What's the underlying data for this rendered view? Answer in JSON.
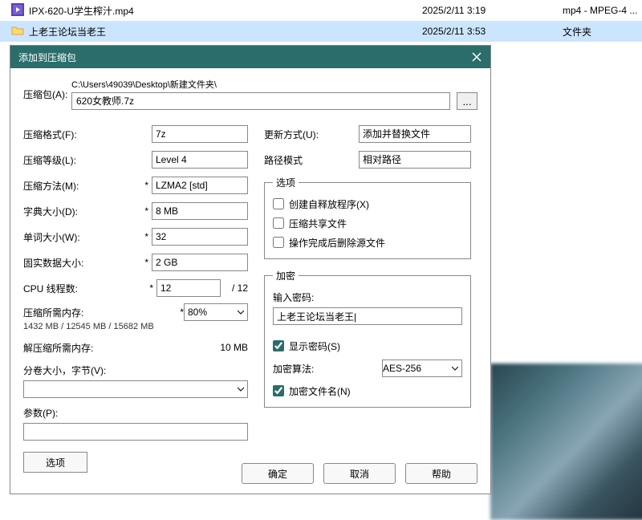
{
  "files": [
    {
      "name": "IPX-620-U学生榨汁.mp4",
      "date": "2025/2/11 3:19",
      "type": "mp4 - MPEG-4 ..."
    },
    {
      "name": "上老王论坛当老王",
      "date": "2025/2/11 3:53",
      "type": "文件夹"
    }
  ],
  "dialog": {
    "title": "添加到压缩包",
    "archive_label": "压缩包(A):",
    "archive_dir": "C:\\Users\\49039\\Desktop\\新建文件夹\\",
    "archive_name": "620女教师.7z",
    "browse": "...",
    "left": {
      "format_label": "压缩格式(F):",
      "format_value": "7z",
      "level_label": "压缩等级(L):",
      "level_value": "Level 4",
      "method_label": "压缩方法(M):",
      "method_value": "LZMA2 [std]",
      "dict_label": "字典大小(D):",
      "dict_value": "8 MB",
      "word_label": "单词大小(W):",
      "word_value": "32",
      "solid_label": "固实数据大小:",
      "solid_value": "2 GB",
      "cpu_label": "CPU 线程数:",
      "cpu_value": "12",
      "cpu_total": "/ 12",
      "mem_comp_label": "压缩所需内存:",
      "mem_comp_detail": "1432 MB / 12545 MB / 15682 MB",
      "mem_comp_percent": "80%",
      "mem_decomp_label": "解压缩所需内存:",
      "mem_decomp_value": "10 MB",
      "split_label": "分卷大小，字节(V):",
      "params_label": "参数(P):",
      "options_btn": "选项"
    },
    "right": {
      "update_label": "更新方式(U):",
      "update_value": "添加并替换文件",
      "pathmode_label": "路径模式",
      "pathmode_value": "相对路径",
      "options_legend": "选项",
      "sfx_label": "创建自释放程序(X)",
      "shared_label": "压缩共享文件",
      "delete_label": "操作完成后删除源文件",
      "enc_legend": "加密",
      "enc_pwd_label": "输入密码:",
      "enc_pwd_value": "上老王论坛当老王|",
      "show_pwd_label": "显示密码(S)",
      "enc_alg_label": "加密算法:",
      "enc_alg_value": "AES-256",
      "enc_name_label": "加密文件名(N)"
    },
    "buttons": {
      "ok": "确定",
      "cancel": "取消",
      "help": "帮助"
    }
  }
}
